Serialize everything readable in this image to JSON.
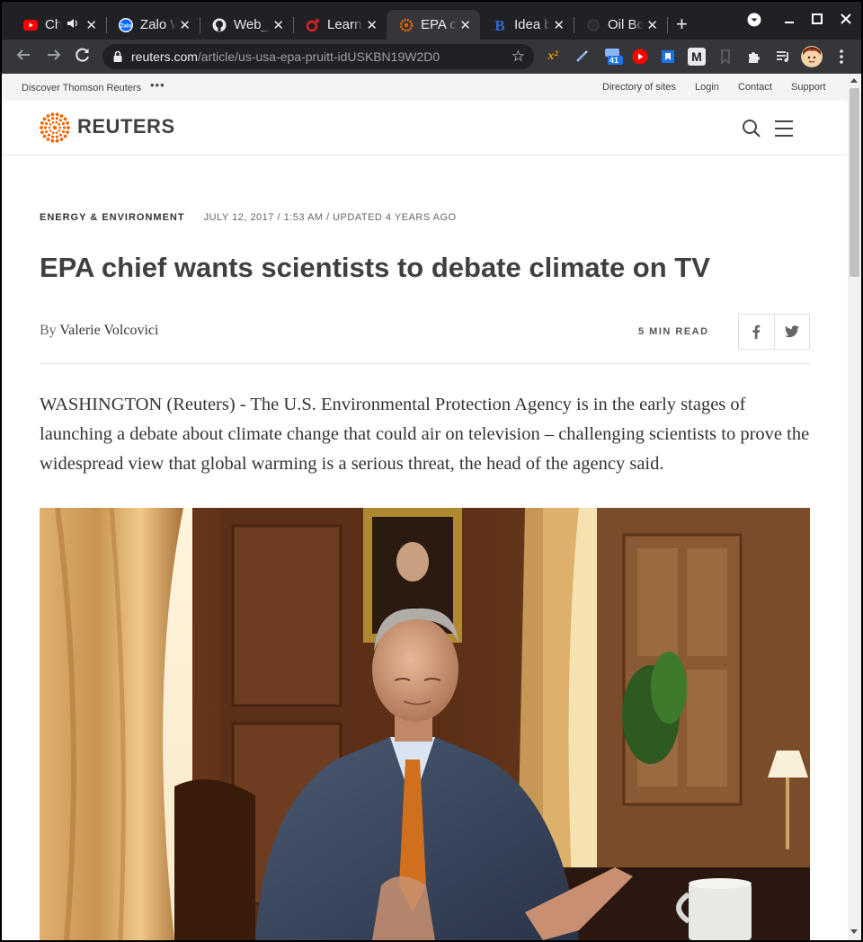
{
  "browser": {
    "tabs": [
      {
        "title": "Ch",
        "icon": "youtube-icon",
        "audio": true
      },
      {
        "title": "Zalo Web",
        "icon": "zalo-icon"
      },
      {
        "title": "Web_",
        "icon": "github-icon"
      },
      {
        "title": "Learn",
        "icon": "learn-icon"
      },
      {
        "title": "EPA chief",
        "icon": "reuters-icon",
        "active": true
      },
      {
        "title": "Idea b",
        "icon": "b-icon"
      },
      {
        "title": "Oil Bo",
        "icon": "oil-icon"
      }
    ],
    "tab_close_glyph": "✕",
    "new_tab_glyph": "+",
    "url_domain": "reuters.com",
    "url_path": "/article/us-usa-epa-pruitt-idUSKBN19W2D0",
    "ext_badge_count": "41",
    "ext_superscript_label": "x²",
    "ext_m_label": "M"
  },
  "site": {
    "discover_label": "Discover Thomson Reuters",
    "more_dots": "•••",
    "util_links": [
      "Directory of sites",
      "Login",
      "Contact",
      "Support"
    ],
    "logo_text": "REUTERS",
    "brand_color": "#fa6400"
  },
  "article": {
    "category": "ENERGY & ENVIRONMENT",
    "date": "JULY 12, 2017 / 1:53 AM / UPDATED 4 YEARS AGO",
    "headline": "EPA chief wants scientists to debate climate on TV",
    "by_prefix": "By",
    "author": "Valerie Volcovici",
    "read_time": "5 MIN READ",
    "lede": "WASHINGTON (Reuters) - The U.S. Environmental Protection Agency is in the early stages of launching a debate about climate change that could air on television – challenging scientists to prove the widespread view that global warming is a serious threat, the head of the agency said."
  }
}
